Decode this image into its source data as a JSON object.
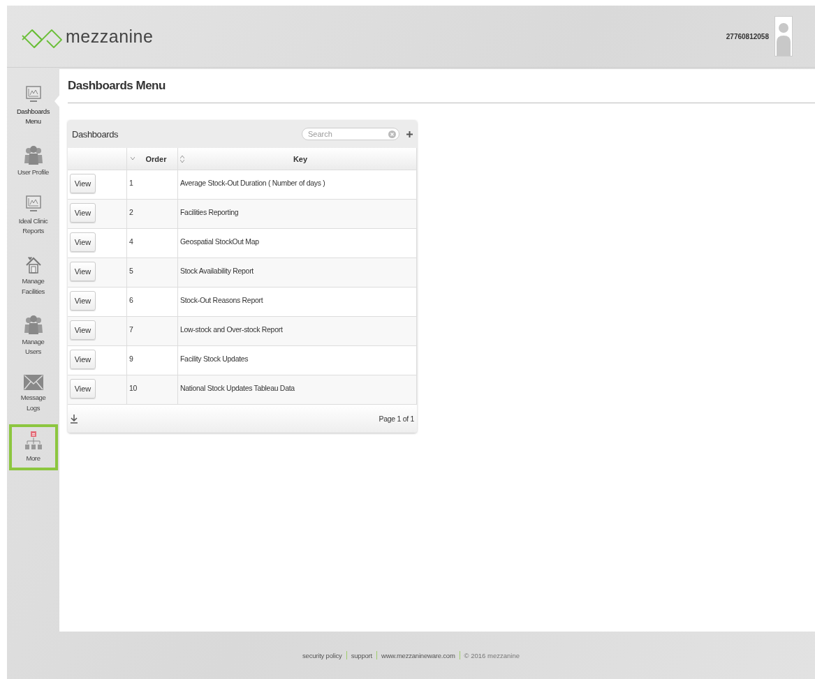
{
  "header": {
    "logo_text": "mezzanine",
    "username": "27760812058"
  },
  "sidebar": {
    "items": [
      {
        "kind": "chart",
        "label": "Dashboards Menu",
        "selected": true,
        "highlighted": false
      },
      {
        "kind": "users",
        "label": "User Profile",
        "selected": false,
        "highlighted": false
      },
      {
        "kind": "chart",
        "label": "Ideal Clinic Reports",
        "selected": false,
        "highlighted": false
      },
      {
        "kind": "house",
        "label": "Manage Facilities",
        "selected": false,
        "highlighted": false
      },
      {
        "kind": "users",
        "label": "Manage Users",
        "selected": false,
        "highlighted": false
      },
      {
        "kind": "mail",
        "label": "Message Logs",
        "selected": false,
        "highlighted": false
      },
      {
        "kind": "tree",
        "label": "More",
        "selected": false,
        "highlighted": true
      }
    ]
  },
  "page_title": "Dashboards Menu",
  "table": {
    "title": "Dashboards",
    "search": {
      "placeholder": "Search"
    },
    "columns": [
      {},
      {
        "label": "Order"
      },
      {
        "label": "Key"
      }
    ],
    "rows": [
      {
        "button": "View",
        "order": "1",
        "key": "Average Stock-Out Duration ( Number of days )"
      },
      {
        "button": "View",
        "order": "2",
        "key": "Facilities Reporting"
      },
      {
        "button": "View",
        "order": "4",
        "key": "Geospatial StockOut Map"
      },
      {
        "button": "View",
        "order": "5",
        "key": "Stock Availability Report"
      },
      {
        "button": "View",
        "order": "6",
        "key": "Stock-Out Reasons Report"
      },
      {
        "button": "View",
        "order": "7",
        "key": "Low-stock and Over-stock Report"
      },
      {
        "button": "View",
        "order": "9",
        "key": "Facility Stock Updates"
      },
      {
        "button": "View",
        "order": "10",
        "key": "National Stock Updates Tableau Data"
      }
    ],
    "pager": "Page 1 of 1"
  },
  "footer": {
    "links": [
      "security policy",
      "support",
      "www.mezzanineware.com"
    ],
    "copyright": "© 2016 mezzanine"
  }
}
